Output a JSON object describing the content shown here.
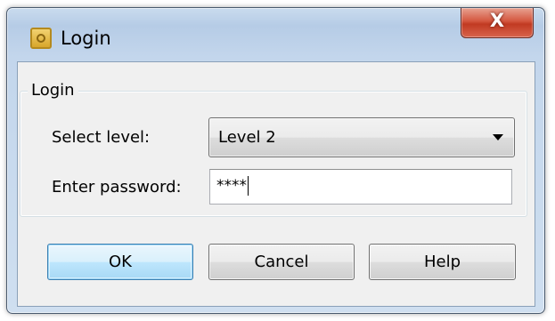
{
  "window": {
    "title": "Login",
    "close_glyph": "X"
  },
  "group": {
    "legend": "Login"
  },
  "form": {
    "level_label": "Select level:",
    "level_value": "Level 2",
    "password_label": "Enter password:",
    "password_value": "****"
  },
  "buttons": {
    "ok": "OK",
    "cancel": "Cancel",
    "help": "Help"
  }
}
